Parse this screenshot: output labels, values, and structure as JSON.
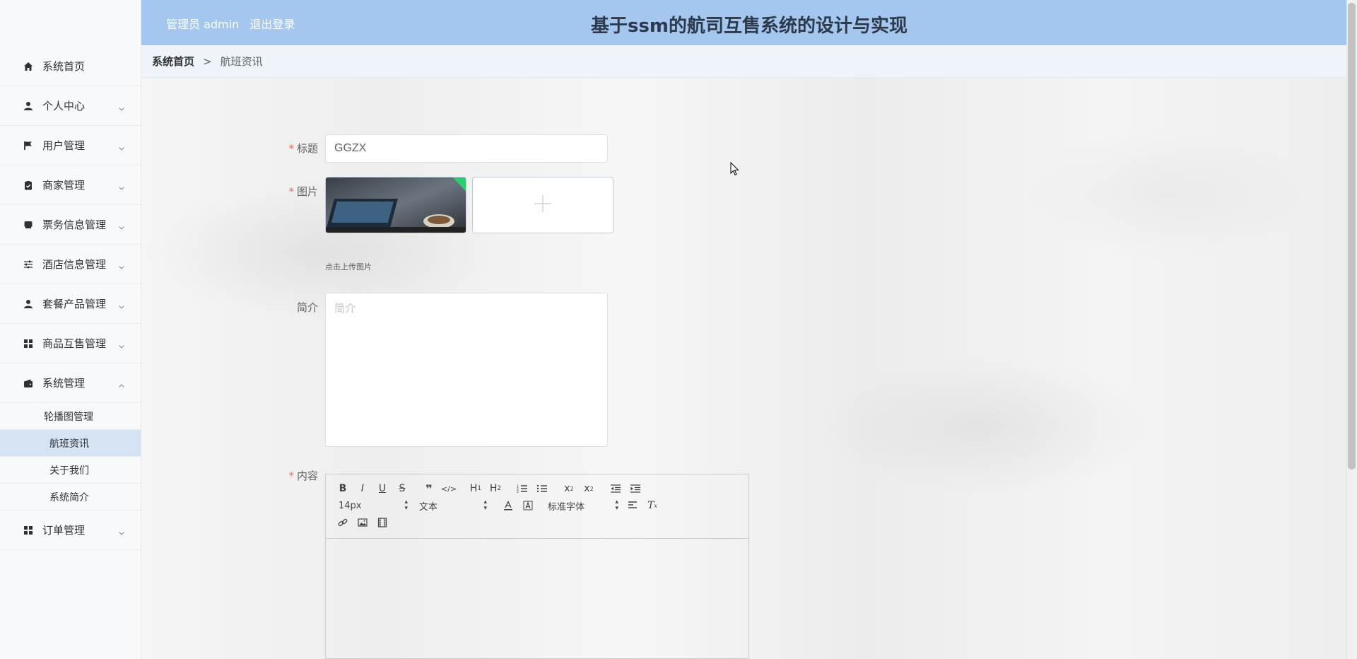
{
  "app": {
    "title": "基于ssm的航司互售系统的设计与实现",
    "user_label": "管理员 admin",
    "logout_label": "退出登录"
  },
  "sidebar": {
    "items": [
      {
        "label": "系统首页",
        "icon": "home-icon",
        "has_arrow": false
      },
      {
        "label": "个人中心",
        "icon": "user-icon",
        "has_arrow": true
      },
      {
        "label": "用户管理",
        "icon": "flag-icon",
        "has_arrow": true
      },
      {
        "label": "商家管理",
        "icon": "clipboard-check-icon",
        "has_arrow": true
      },
      {
        "label": "票务信息管理",
        "icon": "ticket-icon",
        "has_arrow": true
      },
      {
        "label": "酒店信息管理",
        "icon": "sliders-icon",
        "has_arrow": true
      },
      {
        "label": "套餐产品管理",
        "icon": "user-icon",
        "has_arrow": true
      },
      {
        "label": "商品互售管理",
        "icon": "grid-icon",
        "has_arrow": true
      },
      {
        "label": "系统管理",
        "icon": "wallet-icon",
        "has_arrow": true,
        "expanded": true
      },
      {
        "label": "订单管理",
        "icon": "grid-icon",
        "has_arrow": true
      }
    ],
    "system_submenu": [
      {
        "label": "轮播图管理"
      },
      {
        "label": "航班资讯",
        "active": true
      },
      {
        "label": "关于我们"
      },
      {
        "label": "系统简介"
      }
    ]
  },
  "breadcrumb": {
    "home": "系统首页",
    "separator": ">",
    "current": "航班资讯"
  },
  "form": {
    "title_label": "标题",
    "title_value": "GGZX",
    "image_label": "图片",
    "upload_hint": "点击上传图片",
    "intro_label": "简介",
    "intro_placeholder": "简介",
    "content_label": "内容",
    "required_mark": "*"
  },
  "editor": {
    "font_size": "14px",
    "header_select": "文本",
    "font_family": "标准字体",
    "buttons_row1": [
      "B",
      "I",
      "U",
      "S",
      "❞",
      "</>",
      "H1",
      "H2",
      "ol",
      "ul",
      "x₂",
      "x²",
      "outdent",
      "indent"
    ],
    "buttons_row2": [
      "color",
      "background",
      "align",
      "clean"
    ],
    "buttons_row3": [
      "link",
      "image",
      "video"
    ]
  },
  "colors": {
    "header_bg": "#a5c6ee",
    "sidebar_bg": "#f7f9fb",
    "active_submenu_bg": "#d5e3f2",
    "required": "#f56c6c"
  }
}
